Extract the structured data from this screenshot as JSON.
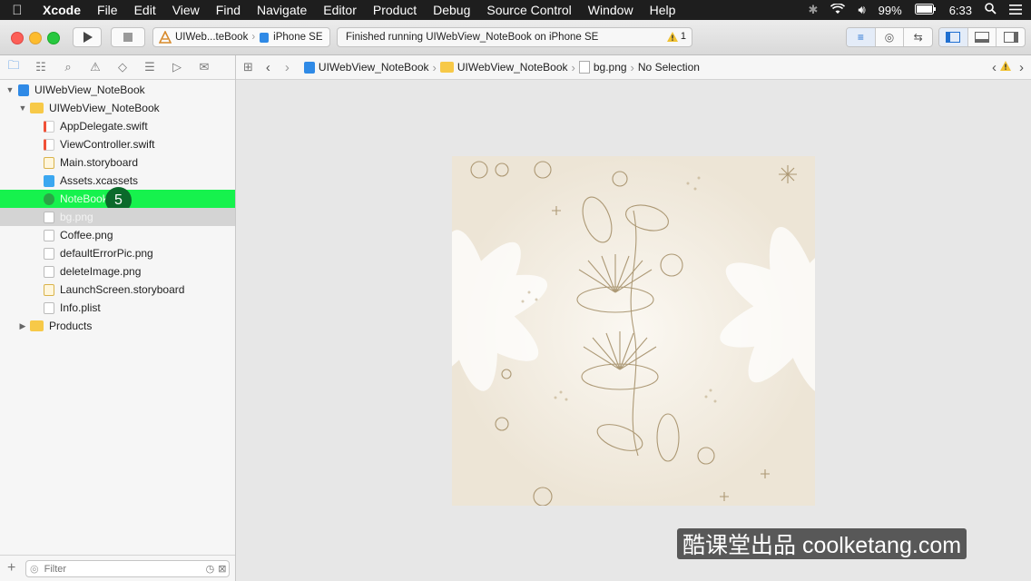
{
  "menubar": {
    "app": "Xcode",
    "items": [
      "File",
      "Edit",
      "View",
      "Find",
      "Navigate",
      "Editor",
      "Product",
      "Debug",
      "Source Control",
      "Window",
      "Help"
    ],
    "battery": "99%",
    "time": "6:33"
  },
  "toolbar": {
    "scheme_project": "UIWeb...teBook",
    "scheme_device": "iPhone SE",
    "activity_text": "Finished running UIWebView_NoteBook on iPhone SE",
    "warning_count": "1"
  },
  "navigator": {
    "items": [
      {
        "label": "UIWebView_NoteBook",
        "kind": "project"
      },
      {
        "label": "UIWebView_NoteBook",
        "kind": "folder"
      },
      {
        "label": "AppDelegate.swift",
        "kind": "swift"
      },
      {
        "label": "ViewController.swift",
        "kind": "swift"
      },
      {
        "label": "Main.storyboard",
        "kind": "storyboard"
      },
      {
        "label": "Assets.xcassets",
        "kind": "assets"
      },
      {
        "label": "NoteBook",
        "kind": "html"
      },
      {
        "label": "bg.png",
        "kind": "png"
      },
      {
        "label": "Coffee.png",
        "kind": "png"
      },
      {
        "label": "defaultErrorPic.png",
        "kind": "png"
      },
      {
        "label": "deleteImage.png",
        "kind": "png"
      },
      {
        "label": "LaunchScreen.storyboard",
        "kind": "storyboard"
      },
      {
        "label": "Info.plist",
        "kind": "plist"
      },
      {
        "label": "Products",
        "kind": "folder"
      }
    ],
    "step_badge": "5",
    "filter_placeholder": "Filter"
  },
  "jumpbar": {
    "crumbs": [
      "UIWebView_NoteBook",
      "UIWebView_NoteBook",
      "bg.png",
      "No Selection"
    ]
  },
  "watermark": "酷课堂出品 coolketang.com",
  "colors": {
    "highlight": "#16f24d",
    "badge": "#0b6a2b",
    "accent": "#1f7ae0",
    "folder": "#f7c948"
  }
}
